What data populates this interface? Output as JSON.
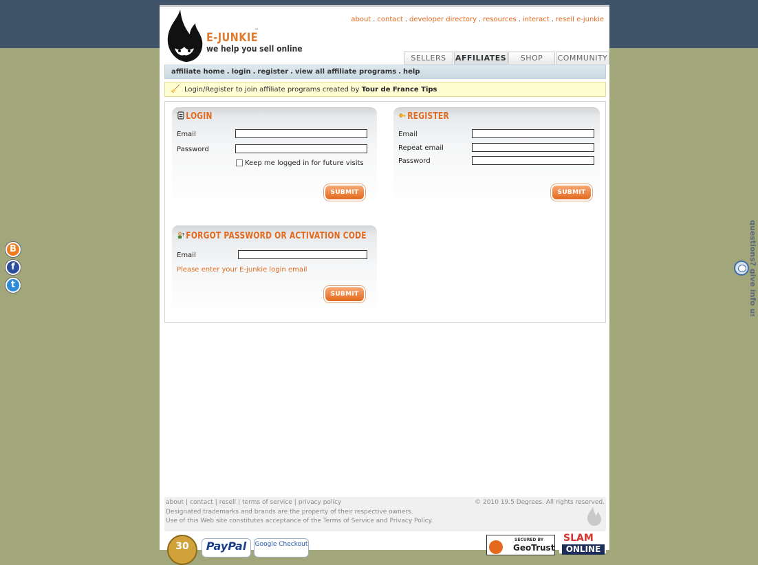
{
  "brand": {
    "name": "E-JUNKIE",
    "tm": "™",
    "tagline": "we help you sell online"
  },
  "top_nav": [
    "about",
    "contact",
    "developer directory",
    "resources",
    "interact",
    "resell e-junkie"
  ],
  "tabs": [
    {
      "label": "SELLERS",
      "active": false
    },
    {
      "label": "AFFILIATES",
      "active": true
    },
    {
      "label": "SHOP",
      "active": false
    },
    {
      "label": "COMMUNITY",
      "active": false
    }
  ],
  "sub_nav": [
    "affiliate home",
    "login",
    "register",
    "view all affiliate programs",
    "help"
  ],
  "notice": {
    "text": "Login/Register to join affiliate programs created by",
    "bold": "Tour de France Tips"
  },
  "login": {
    "title": "LOGIN",
    "email_label": "Email",
    "password_label": "Password",
    "remember_label": "Keep me logged in for future visits",
    "remember_checked": false,
    "submit_label": "SUBMIT"
  },
  "register": {
    "title": "REGISTER",
    "email_label": "Email",
    "repeat_email_label": "Repeat email",
    "password_label": "Password",
    "submit_label": "SUBMIT"
  },
  "forgot": {
    "title": "FORGOT PASSWORD OR ACTIVATION CODE",
    "email_label": "Email",
    "hint": "Please enter your E-junkie login email",
    "submit_label": "SUBMIT"
  },
  "footer": {
    "links": [
      "about",
      "contact",
      "resell",
      "terms of service",
      "privacy policy"
    ],
    "copyright": "© 2010 19.5 Degrees. All rights reserved.",
    "line2": "Designated trademarks and brands are the property of their respective owners.",
    "line3": "Use of this Web site constitutes acceptance of the Terms of Service and Privacy Policy."
  },
  "badges": {
    "money_back": "30",
    "paypal": "PayPal",
    "google": "Google Checkout",
    "geotrust_small": "SECURED BY",
    "geotrust": "GeoTrust",
    "slam": "SLAM",
    "slam_online": "ONLINE"
  },
  "side": {
    "share_icons": [
      "blogger-icon",
      "facebook-icon",
      "twitter-icon"
    ],
    "feedback_text": "questions? give info us"
  },
  "colors": {
    "accent": "#e2691e",
    "header_band": "#3f5468",
    "background": "#a1a67b",
    "notice_bg": "#fffdd2"
  }
}
